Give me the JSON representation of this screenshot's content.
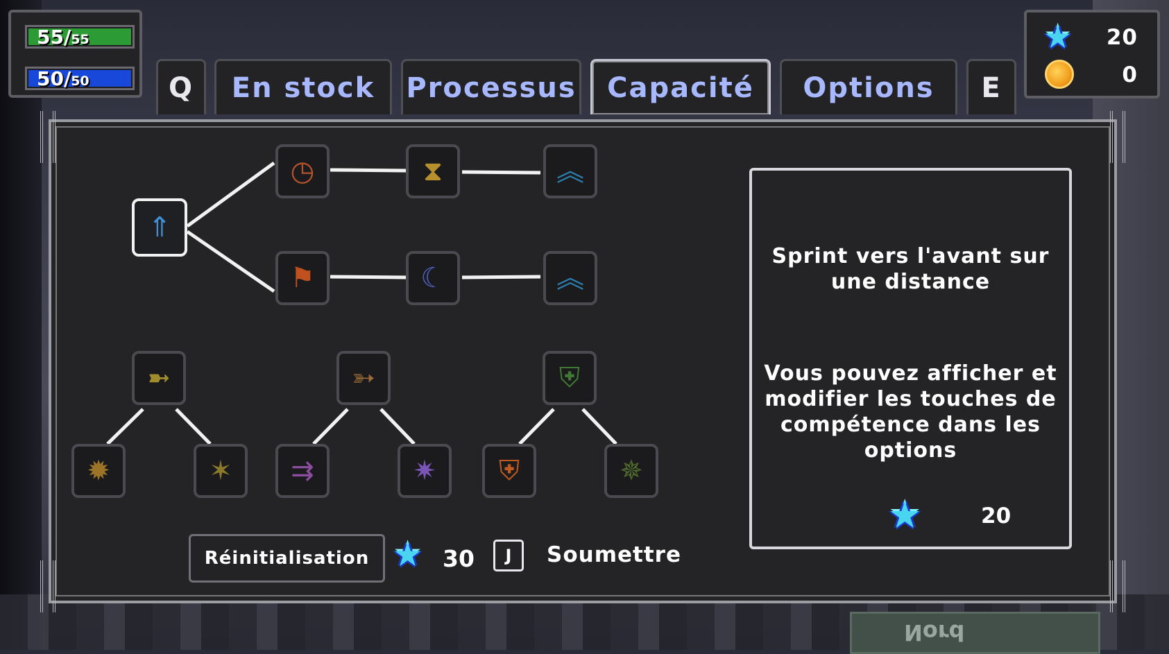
{
  "hud": {
    "hp_current": "55/",
    "hp_max": "55",
    "mp_current": "50/",
    "mp_max": "50",
    "hp_color": "#2c9b36",
    "mp_color": "#1748d9"
  },
  "currency": {
    "skill_points": "20",
    "gold": "0",
    "skill_point_icon": "blue-star-icon",
    "gold_icon": "gold-coin-icon"
  },
  "tabs": {
    "prev_key": "Q",
    "next_key": "E",
    "items": [
      {
        "label": "En stock"
      },
      {
        "label": "Processus"
      },
      {
        "label": "Capacité",
        "active": true
      },
      {
        "label": "Options"
      }
    ]
  },
  "skill_tree": {
    "nodes": [
      {
        "id": "dash",
        "icon": "dash-arrow-icon",
        "selected": true
      },
      {
        "id": "clock",
        "icon": "clock-icon"
      },
      {
        "id": "hourglass",
        "icon": "hourglass-icon"
      },
      {
        "id": "upgrade-1",
        "icon": "double-chevron-up-icon"
      },
      {
        "id": "runner",
        "icon": "running-figure-icon"
      },
      {
        "id": "crescent",
        "icon": "crescent-slash-icon"
      },
      {
        "id": "upgrade-2",
        "icon": "double-chevron-up-icon"
      },
      {
        "id": "charge",
        "icon": "charging-figure-icon"
      },
      {
        "id": "burst",
        "icon": "burst-figure-icon"
      },
      {
        "id": "cheer",
        "icon": "cheering-figure-icon"
      },
      {
        "id": "arrow-hit",
        "icon": "arrow-impact-icon"
      },
      {
        "id": "double-arrow",
        "icon": "double-arrow-icon"
      },
      {
        "id": "spark-arrow",
        "icon": "spark-arrow-icon"
      },
      {
        "id": "shield",
        "icon": "green-shield-icon"
      },
      {
        "id": "fire-shield",
        "icon": "fire-shield-icon"
      },
      {
        "id": "aura",
        "icon": "aura-figure-icon"
      }
    ]
  },
  "info": {
    "description": "Sprint vers l'avant sur une distance",
    "hint": "Vous pouvez afficher et modifier les touches de compétence dans les options",
    "cost": "20"
  },
  "footer": {
    "reset_label": "Réinitialisation",
    "reset_cost": "30",
    "submit_key": "J",
    "submit_label": "Soumettre"
  },
  "background": {
    "sign_text": "Nord"
  }
}
